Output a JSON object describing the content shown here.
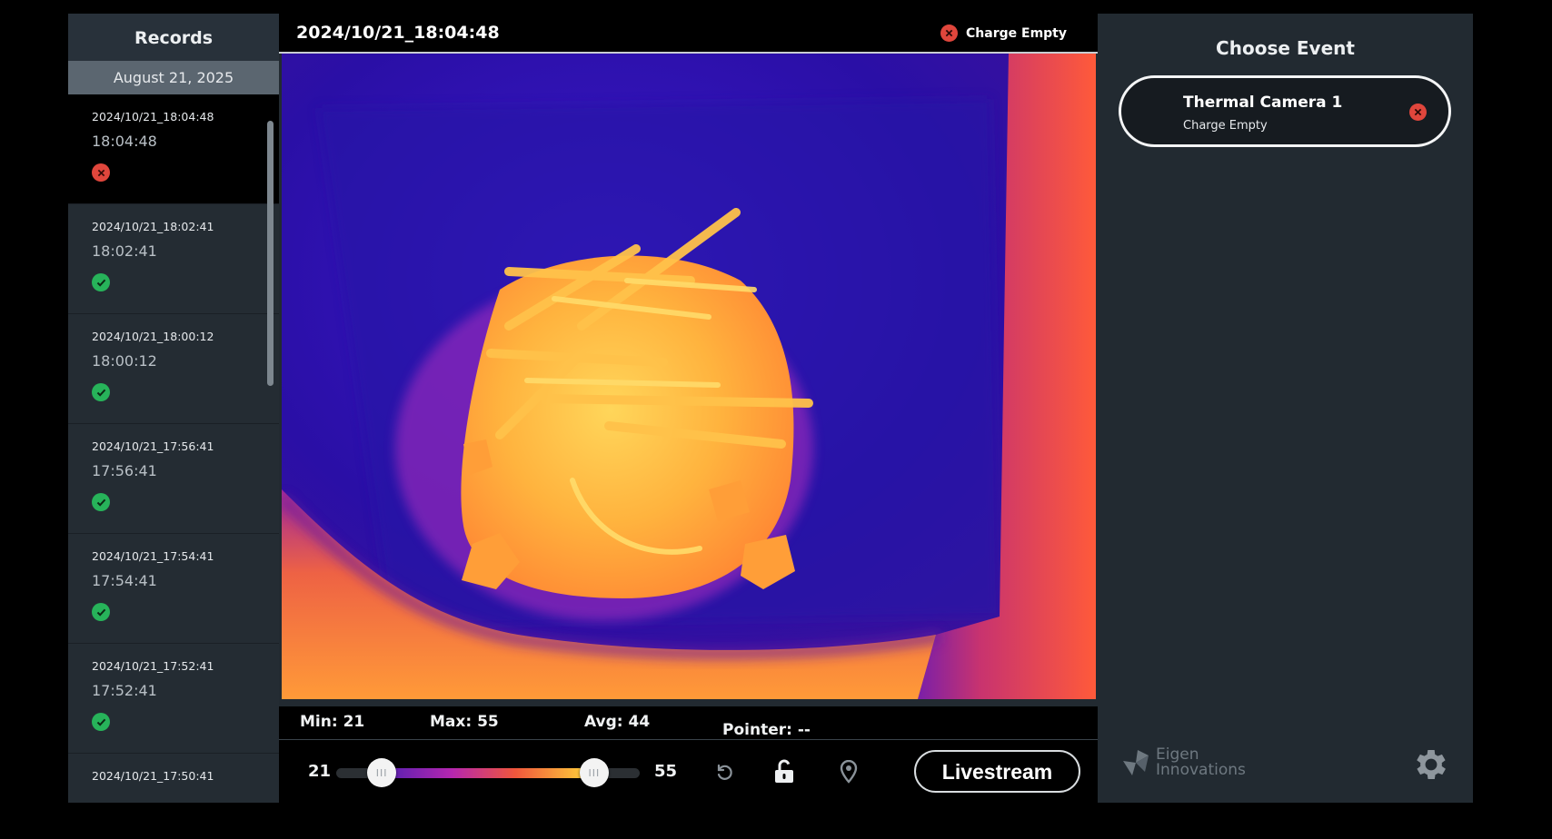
{
  "sidebar": {
    "title": "Records",
    "date": "August 21, 2025",
    "records": [
      {
        "timestamp": "2024/10/21_18:04:48",
        "time": "18:04:48",
        "status": "error"
      },
      {
        "timestamp": "2024/10/21_18:02:41",
        "time": "18:02:41",
        "status": "ok"
      },
      {
        "timestamp": "2024/10/21_18:00:12",
        "time": "18:00:12",
        "status": "ok"
      },
      {
        "timestamp": "2024/10/21_17:56:41",
        "time": "17:56:41",
        "status": "ok"
      },
      {
        "timestamp": "2024/10/21_17:54:41",
        "time": "17:54:41",
        "status": "ok"
      },
      {
        "timestamp": "2024/10/21_17:52:41",
        "time": "17:52:41",
        "status": "ok"
      },
      {
        "timestamp": "2024/10/21_17:50:41",
        "time": "",
        "status": ""
      }
    ]
  },
  "viewer": {
    "timestamp": "2024/10/21_18:04:48",
    "status_label": "Charge Empty",
    "status_icon": "close-circle-icon",
    "stats": {
      "min": "Min: 21",
      "max": "Max: 55",
      "avg": "Avg: 44",
      "pointer": "Pointer: --"
    },
    "range": {
      "min_label": "21",
      "max_label": "55",
      "low_fraction": 0.15,
      "high_fraction": 0.85
    },
    "controls": {
      "reset_icon": "rotate-left-icon",
      "lock_icon": "unlock-icon",
      "pointer_icon": "map-pin-icon",
      "livestream_label": "Livestream"
    }
  },
  "event_panel": {
    "title": "Choose Event",
    "events": [
      {
        "name": "Thermal Camera 1",
        "status": "Charge Empty",
        "status_icon": "close-circle-icon"
      }
    ]
  },
  "branding": {
    "line1": "Eigen",
    "line2": "Innovations"
  },
  "settings_icon": "gear-icon",
  "colors": {
    "error": "#e0463c",
    "ok": "#27b35a",
    "sidebar_bg": "#242c33",
    "panel_bg": "#222a31"
  }
}
